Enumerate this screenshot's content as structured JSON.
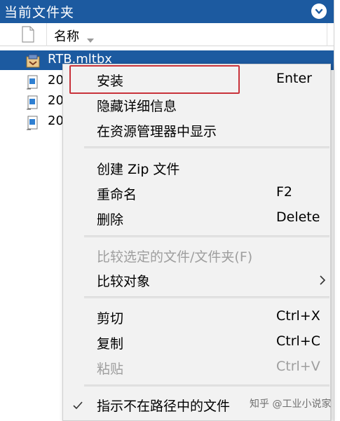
{
  "panel": {
    "title": "当前文件夹",
    "header_bg": "#1c5aa0"
  },
  "columns": {
    "name_header": "名称",
    "sort_indicator": "sort-down"
  },
  "files": [
    {
      "name": "RTB.mltbx",
      "icon": "toolbox-package-icon",
      "selected": true
    },
    {
      "name": "20",
      "icon": "script-file-icon",
      "selected": false
    },
    {
      "name": "20",
      "icon": "script-file-icon",
      "selected": false
    },
    {
      "name": "20",
      "icon": "script-file-icon",
      "selected": false
    }
  ],
  "context_menu": {
    "items": [
      {
        "label": "安装",
        "shortcut": "Enter",
        "enabled": true,
        "highlighted": true
      },
      {
        "label": "隐藏详细信息",
        "shortcut": "",
        "enabled": true
      },
      {
        "label": "在资源管理器中显示",
        "shortcut": "",
        "enabled": true
      },
      {
        "label": "创建 Zip 文件",
        "shortcut": "",
        "enabled": true
      },
      {
        "label": "重命名",
        "shortcut": "F2",
        "enabled": true
      },
      {
        "label": "删除",
        "shortcut": "Delete",
        "enabled": true
      },
      {
        "label": "比较选定的文件/文件夹(F)",
        "shortcut": "",
        "enabled": false
      },
      {
        "label": "比较对象",
        "shortcut": "",
        "enabled": true,
        "submenu": true
      },
      {
        "label": "剪切",
        "shortcut": "Ctrl+X",
        "enabled": true
      },
      {
        "label": "复制",
        "shortcut": "Ctrl+C",
        "enabled": true
      },
      {
        "label": "粘贴",
        "shortcut": "Ctrl+V",
        "enabled": false
      },
      {
        "label": "指示不在路径中的文件",
        "shortcut": "",
        "enabled": true,
        "checked": true
      }
    ],
    "highlight_color": "#c8323a"
  },
  "watermark": "知乎 @工业小说家"
}
